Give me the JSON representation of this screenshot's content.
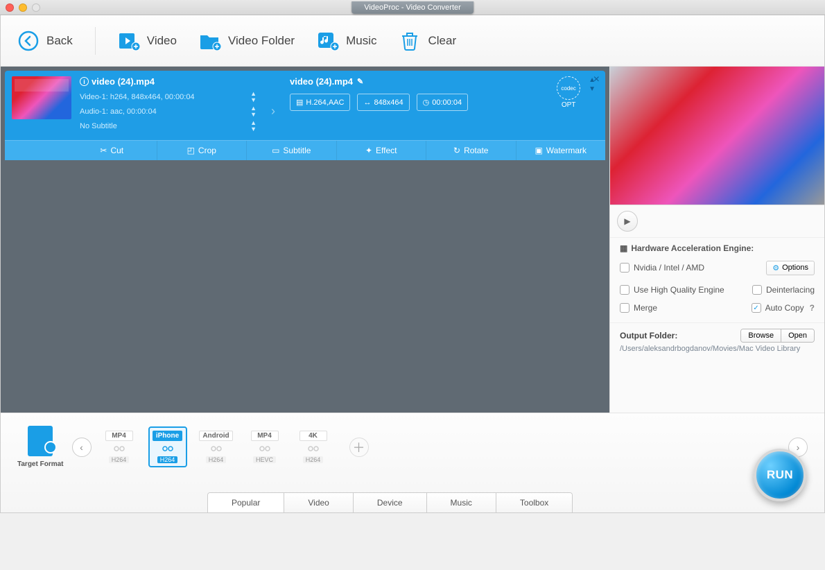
{
  "title": "VideoProc - Video Converter",
  "toolbar": {
    "back": "Back",
    "video": "Video",
    "folder": "Video Folder",
    "music": "Music",
    "clear": "Clear"
  },
  "item": {
    "src_name": "video (24).mp4",
    "video_line": "Video-1: h264, 848x464, 00:00:04",
    "audio_line": "Audio-1: aac, 00:00:04",
    "sub_line": "No Subtitle",
    "dst_name": "video (24).mp4",
    "codec": "H.264,AAC",
    "res": "848x464",
    "dur": "00:00:04",
    "opt": "OPT"
  },
  "tools": {
    "cut": "Cut",
    "crop": "Crop",
    "subtitle": "Subtitle",
    "effect": "Effect",
    "rotate": "Rotate",
    "watermark": "Watermark"
  },
  "hw": {
    "title": "Hardware Acceleration Engine:",
    "chip": "Nvidia / Intel / AMD",
    "options": "Options",
    "hq": "Use High Quality Engine",
    "deint": "Deinterlacing",
    "merge": "Merge",
    "auto": "Auto Copy"
  },
  "output": {
    "label": "Output Folder:",
    "browse": "Browse",
    "open": "Open",
    "path": "/Users/aleksandrbogdanov/Movies/Mac Video Library"
  },
  "target": {
    "label": "Target Format"
  },
  "formats": [
    {
      "top": "MP4",
      "bot": "H264",
      "sel": false
    },
    {
      "top": "iPhone",
      "bot": "H264",
      "sel": true
    },
    {
      "top": "Android",
      "bot": "H264",
      "sel": false
    },
    {
      "top": "MP4",
      "bot": "HEVC",
      "sel": false
    },
    {
      "top": "4K",
      "bot": "H264",
      "sel": false
    }
  ],
  "tabs": {
    "popular": "Popular",
    "video": "Video",
    "device": "Device",
    "music": "Music",
    "toolbox": "Toolbox"
  },
  "run": "RUN"
}
